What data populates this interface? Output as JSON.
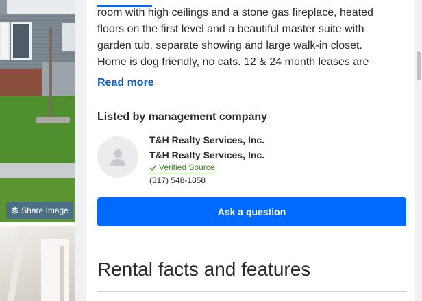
{
  "gallery": {
    "share_label": "Share Image",
    "share_icon": "layers-icon"
  },
  "description": {
    "lines": [
      "room with high ceilings and a stone gas fireplace, heated",
      "floors on the first level and a beautiful master suite with",
      "garden tub, separate showing and large walk-in closet.",
      "Home is dog friendly, no cats. 12 & 24 month leases are"
    ],
    "read_more": "Read more"
  },
  "listing_agent": {
    "heading": "Listed by management company",
    "avatar_icon": "person-icon",
    "name_primary": "T&H Realty Services, Inc.",
    "name_secondary": "T&H Realty Services, Inc.",
    "verified_label": "Verified Source",
    "verified_icon": "checkmark-icon",
    "phone": "(317) 548-1858"
  },
  "actions": {
    "ask_label": "Ask a question"
  },
  "sections": {
    "rental_facts_title": "Rental facts and features"
  },
  "colors": {
    "accent": "#006aff",
    "link": "#0d5ec2",
    "verified": "#3b8a1f",
    "text": "#2a2a33"
  }
}
